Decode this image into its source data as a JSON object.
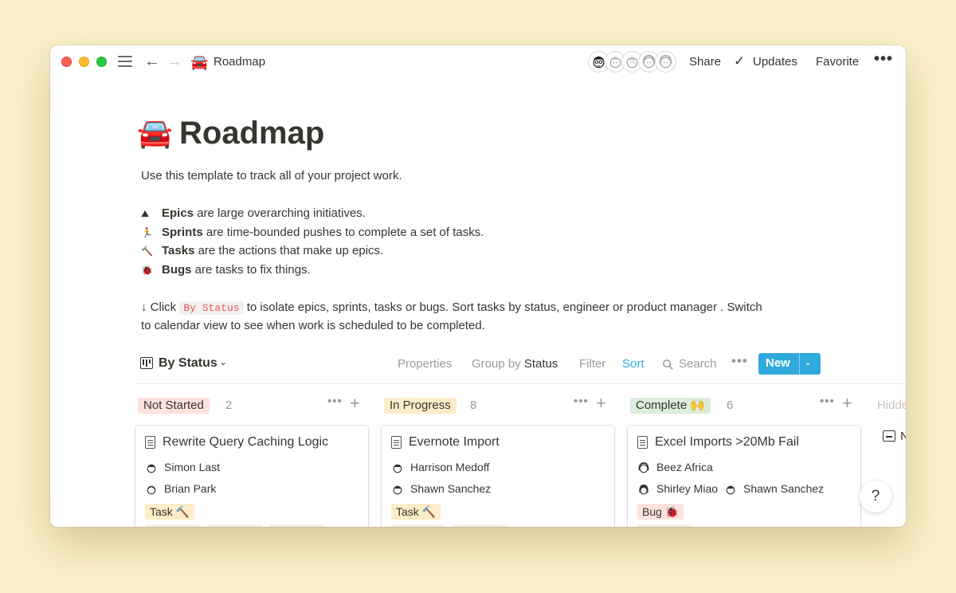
{
  "titlebar": {
    "breadcrumb_emoji": "🚘",
    "breadcrumb_title": "Roadmap",
    "share": "Share",
    "updates": "Updates",
    "favorite": "Favorite",
    "more": "•••"
  },
  "page": {
    "emoji": "🚘",
    "title": "Roadmap",
    "intro": "Use this template to track all of your project work.",
    "bullets": [
      {
        "emoji": "⛰",
        "term": "Epics",
        "text": " are large overarching initiatives."
      },
      {
        "emoji": "🏃",
        "term": "Sprints",
        "text": " are time-bounded pushes to complete a set of tasks."
      },
      {
        "emoji": "🔨",
        "term": "Tasks",
        "text": " are the actions that make up epics."
      },
      {
        "emoji": "🐞",
        "term": "Bugs",
        "text": " are tasks to fix things."
      }
    ],
    "click_pre": "↓ Click ",
    "click_code": "By Status",
    "click_post": " to isolate epics, sprints, tasks or bugs. Sort tasks by status, engineer or product manager . Switch",
    "click_line2": "to calendar view to see when work is scheduled to be completed."
  },
  "toolbar": {
    "view_name": "By Status",
    "properties": "Properties",
    "group_by": "Group by",
    "group_by_value": "Status",
    "filter": "Filter",
    "sort": "Sort",
    "search": "Search",
    "more": "•••",
    "new": "New"
  },
  "columns": [
    {
      "label": "Not Started",
      "count": "2",
      "color": "#ffe2dd"
    },
    {
      "label": "In Progress",
      "count": "8",
      "color": "#fdecc8"
    },
    {
      "label": "Complete 🙌",
      "count": "6",
      "color": "#dbeddb"
    }
  ],
  "column_more": "•••",
  "column_add": "+",
  "hidden": {
    "label": "Hidde",
    "item": "N"
  },
  "cards": [
    {
      "title": "Rewrite Query Caching Logic",
      "p1": "Simon Last",
      "p2": "Brian Park",
      "tag": "Task 🔨",
      "tag_color": "#fdecc8"
    },
    {
      "title": "Evernote Import",
      "p1": "Harrison Medoff",
      "p2": "Shawn Sanchez",
      "tag": "Task 🔨",
      "tag_color": "#fdecc8"
    },
    {
      "title": "Excel Imports >20Mb Fail",
      "p1": "Beez Africa",
      "p2": "Shirley Miao",
      "p3": "Shawn Sanchez",
      "tag": "Bug 🐞",
      "tag_color": "#ffe2dd"
    }
  ],
  "help": "?"
}
